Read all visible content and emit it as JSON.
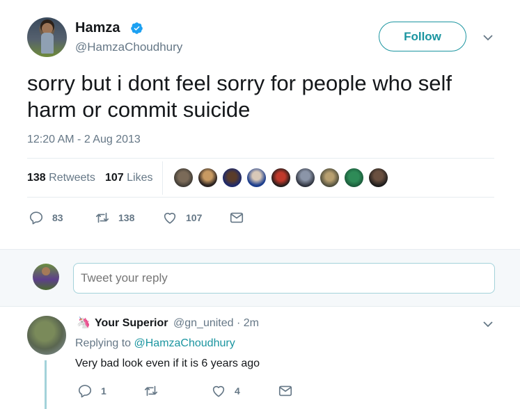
{
  "tweet": {
    "name": "Hamza",
    "handle": "@HamzaChoudhury",
    "follow_label": "Follow",
    "text": "sorry but i dont feel sorry for people who self harm or commit suicide",
    "timestamp": "12:20 AM - 2 Aug 2013",
    "retweets_count": "138",
    "retweets_label": "Retweets",
    "likes_count": "107",
    "likes_label": "Likes",
    "actions": {
      "replies": "83",
      "retweets": "138",
      "likes": "107"
    }
  },
  "reply_box": {
    "placeholder": "Tweet your reply"
  },
  "reply": {
    "name": "Your Superior",
    "handle": "@gn_united",
    "time": "· 2m",
    "replying_prefix": "Replying to",
    "replying_to": "@HamzaChoudhury",
    "text": "Very bad look even if it is 6 years ago",
    "actions": {
      "replies": "1",
      "retweets": "",
      "likes": "4"
    }
  },
  "icons": [
    "verified-badge-icon",
    "chevron-down-icon",
    "reply-icon",
    "retweet-icon",
    "like-icon",
    "message-icon",
    "unicorn-icon"
  ],
  "colors": {
    "accent": "#1b95a0",
    "verified": "#1da1f2",
    "muted": "#657786",
    "text": "#14171a",
    "border": "#e6ecf0"
  }
}
